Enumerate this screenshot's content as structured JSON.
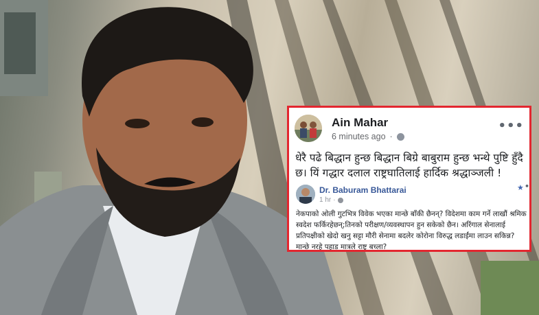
{
  "post": {
    "author": "Ain Mahar",
    "time": "6 minutes ago",
    "separator": "·",
    "more": "•••",
    "text": "धेरै पढे बिद्धान हुन्छ बिद्धान बिग्रे बाबुराम हुन्छ भन्थे पुष्टि हुँदै छ। यिं गद्धार दलाल राष्ट्रघातिलाई हार्दिक श्रद्धाञ्जली !"
  },
  "shared_post": {
    "author": "Dr. Baburam Bhattarai",
    "time": "1 hr",
    "separator": "·",
    "star": "★",
    "more": "•",
    "text": "नेकपाको ओली गुटभित्र विवेक भएका मान्छे बाँकी छैनन्? विदेशमा काम गर्ने लाखौं श्रमिक स्वदेश फर्किरहेछन्;तिनको परीक्षण/व्यवस्थापन हुन सकेको छैन। अरिंगाल सेनालाई प्रतिपक्षीको खेदो खनु सट्टा मौरी सेनामा बदलेर कोरोना विरुद्ध लडाईंमा लाउन सकिन्न? मान्छे नरहे पहाड मात्रले राष्ट्र बच्ला?"
  },
  "colors": {
    "highlight_border": "#e3262f",
    "name": "#1c1e21",
    "link": "#385898",
    "meta": "#65676b"
  },
  "icons": [
    "globe-icon",
    "more-icon",
    "star-icon"
  ]
}
